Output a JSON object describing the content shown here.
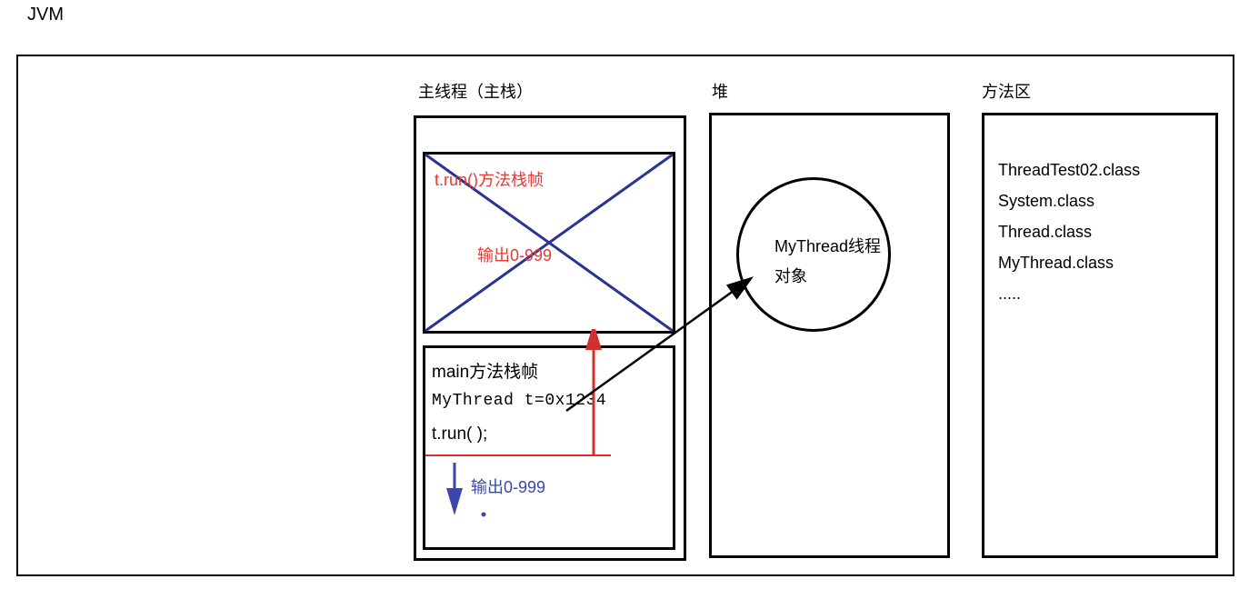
{
  "title": "JVM",
  "labels": {
    "main_stack": "主线程（主栈）",
    "heap": "堆",
    "method_area": "方法区"
  },
  "run_frame": {
    "title": "t.run()方法栈帧",
    "output": "输出0-999"
  },
  "main_frame": {
    "title": "main方法栈帧",
    "line1": "MyThread  t=0x1234",
    "line2": "t.run( );",
    "output": "输出0-999"
  },
  "heap_object": {
    "line1": "MyThread线程",
    "line2": "对象"
  },
  "method_area_items": [
    "ThreadTest02.class",
    "System.class",
    "Thread.class",
    "MyThread.class",
    "....."
  ]
}
